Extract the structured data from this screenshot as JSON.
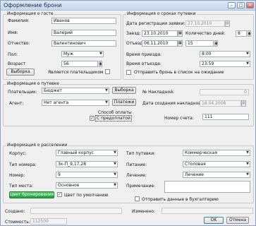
{
  "window": {
    "title": "Оформление брони",
    "minimize": "–",
    "maximize": "□",
    "close": "✕"
  },
  "guest": {
    "group_title": "Информация о госте",
    "surname_label": "Фамилия:",
    "surname": "Иванов",
    "name_label": "Имя:",
    "name": "Валерий",
    "patronymic_label": "Отчество:",
    "patronymic": "Валентинович",
    "sex_label": "Пол:",
    "sex": "Муж",
    "age_label": "Возраст",
    "age": "56",
    "select_button": "Выборка",
    "is_payer_label": "Является плательщиком"
  },
  "dates": {
    "group_title": "Информация о сроках путевки",
    "request_date_label": "Дата регистрации заявки:",
    "request_date": "27.10.2010",
    "arrival_label": "Заезд:",
    "arrival": "23.10.2010",
    "nights_label": "Количество дней:",
    "nights": "8",
    "departure_label": "Отъезд:",
    "departure": "06.11.2010",
    "days": "15",
    "arrival_time_label": "Время приезда:",
    "arrival_time": "8:00",
    "departure_time_label": "Время отъезда:",
    "departure_time": "23:59",
    "waitlist_label": "Отправить бронь в список на ожидание"
  },
  "voucher": {
    "group_title": "Информация о путевке",
    "payer_label": "Плательщик:",
    "payer": "Бюджет",
    "select_button": "Выборка",
    "invoice_label": "№ Накладной:",
    "invoice": "0",
    "agent_label": "Агент:",
    "agent": "Нет агента",
    "payments_button": "Платежи",
    "invoice_date_label": "Дата создания накладной:",
    "invoice_date": "18.04.2008",
    "payment_method_label": "Способ оплаты",
    "prepay_label": "С предоплатой",
    "account_number_label": "Номер счета:",
    "account_number": "111"
  },
  "accommodation": {
    "group_title": "Информация о расселении",
    "building_label": "Корпус:",
    "building": "Главный корпус",
    "room_type_label": "Тип номера:",
    "room_type": "3к-П_9,17,28",
    "room_label": "Номер:",
    "room": "9",
    "bed_type_label": "Тип места:",
    "bed_type": "Основное",
    "voucher_type_label": "Тип путевки:",
    "voucher_type": "Коммерческая",
    "meals_label": "Питание:",
    "meals": "Столовая",
    "treatment_label": "Лечение:",
    "treatment": "Лечение",
    "note_label": "Примечание:",
    "note": "",
    "color_button": "Цвет бронирования",
    "default_color_label": "Цвет по умолчанию",
    "send_accounting_label": "Отправить данные в бухгалтерию"
  },
  "footer": {
    "created_label": "Создано:",
    "changed_label": "Изменено:",
    "cost_label": "Стоимость:",
    "cost": "112500",
    "ok_button": "OK",
    "cancel_button": "Отмена"
  }
}
